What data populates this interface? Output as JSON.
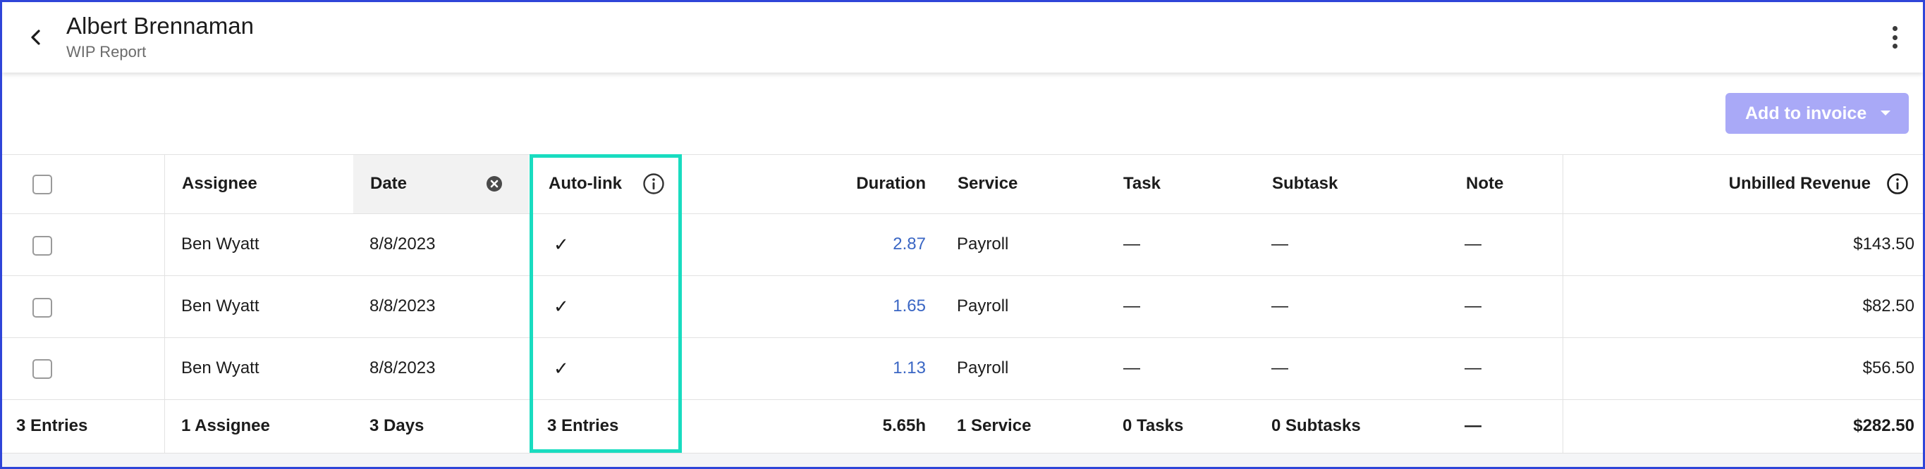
{
  "header": {
    "title": "Albert Brennaman",
    "subtitle": "WIP Report",
    "back_icon": "chevron-left-icon",
    "menu_icon": "more-vertical-icon"
  },
  "toolbar": {
    "add_to_invoice_label": "Add to invoice",
    "add_to_invoice_color": "#a9a9f7"
  },
  "table": {
    "columns": {
      "assignee": "Assignee",
      "date": "Date",
      "autolink": "Auto-link",
      "duration": "Duration",
      "service": "Service",
      "task": "Task",
      "subtask": "Subtask",
      "note": "Note",
      "unbilled_revenue": "Unbilled Revenue"
    },
    "rows": [
      {
        "assignee": "Ben Wyatt",
        "date": "8/8/2023",
        "autolink": "✓",
        "duration": "2.87",
        "service": "Payroll",
        "task": "—",
        "subtask": "—",
        "note": "—",
        "revenue": "$143.50"
      },
      {
        "assignee": "Ben Wyatt",
        "date": "8/8/2023",
        "autolink": "✓",
        "duration": "1.65",
        "service": "Payroll",
        "task": "—",
        "subtask": "—",
        "note": "—",
        "revenue": "$82.50"
      },
      {
        "assignee": "Ben Wyatt",
        "date": "8/8/2023",
        "autolink": "✓",
        "duration": "1.13",
        "service": "Payroll",
        "task": "—",
        "subtask": "—",
        "note": "—",
        "revenue": "$56.50"
      }
    ],
    "totals": {
      "entries": "3 Entries",
      "assignee": "1 Assignee",
      "date": "3 Days",
      "autolink": "3 Entries",
      "duration": "5.65h",
      "service": "1 Service",
      "task": "0 Tasks",
      "subtask": "0 Subtasks",
      "note": "—",
      "revenue": "$282.50"
    }
  },
  "colors": {
    "highlight": "#19dcc0",
    "link": "#3a66c4",
    "frame": "#2f45d8"
  }
}
